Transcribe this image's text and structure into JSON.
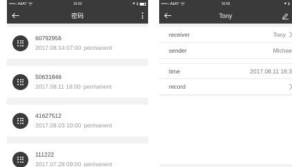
{
  "left": {
    "status": {
      "carrier": "•••••○ A&AT",
      "time": "16:59"
    },
    "nav": {
      "title": "密码"
    },
    "items": [
      {
        "code": "60792956",
        "datetime": "2017.08.14 07:00",
        "type": "permanent"
      },
      {
        "code": "50631846",
        "datetime": "2017.08.11 16:00",
        "type": "permanent"
      },
      {
        "code": "41627512",
        "datetime": "2017.08.03 10:00",
        "type": "permanent"
      },
      {
        "code": "111222",
        "datetime": "2017.07.28 09:00",
        "type": "permanent"
      }
    ]
  },
  "right": {
    "status": {
      "carrier": "•••••○ A&AT",
      "time": "16:59"
    },
    "nav": {
      "title": "Tony"
    },
    "rows": [
      {
        "label": "receiver",
        "value": "Tony"
      },
      {
        "label": "sender",
        "value": "Michae"
      },
      {
        "label": "time",
        "value": "2017.08.11 16:3"
      },
      {
        "label": "record",
        "value": ""
      }
    ]
  },
  "colors": {
    "bar": "#3a3a3a",
    "background": "#f2f2f2",
    "card": "#ffffff"
  },
  "icons": [
    "back-arrow-icon",
    "more-vertical-icon",
    "edit-icon",
    "keypad-icon",
    "chevron-right-icon",
    "wifi-icon",
    "bluetooth-icon",
    "battery-icon"
  ]
}
